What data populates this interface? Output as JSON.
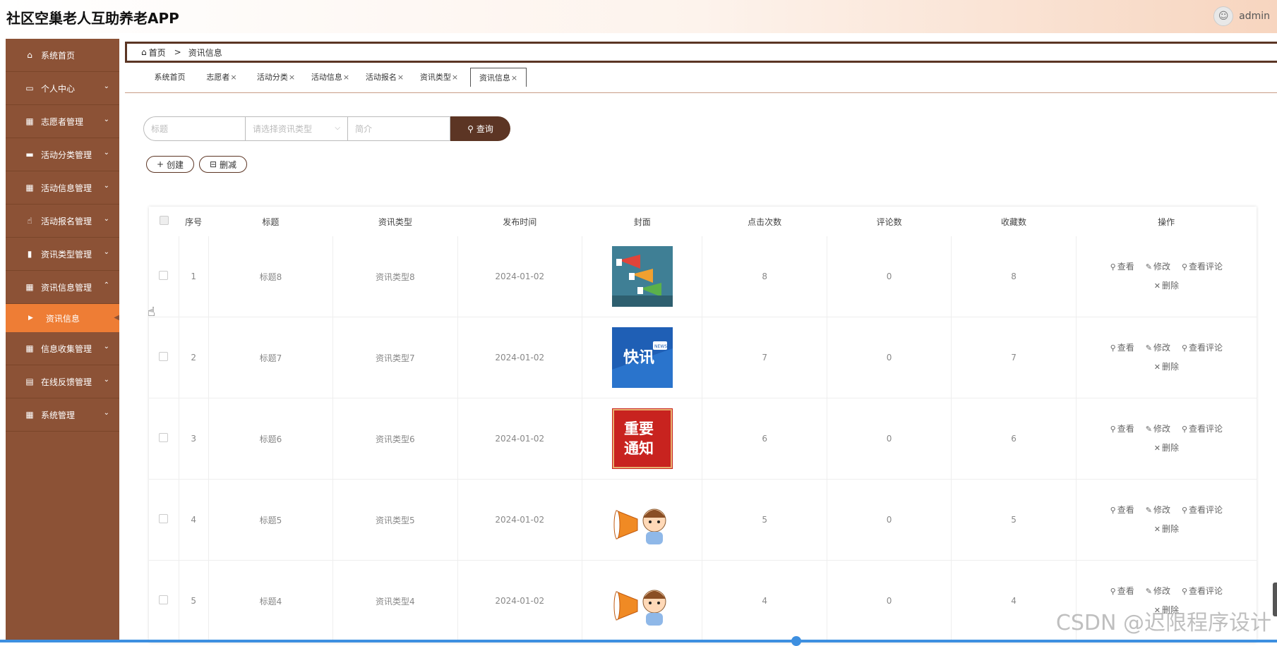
{
  "app": {
    "title": "社区空巢老人互助养老APP",
    "user": "admin"
  },
  "sidebar": {
    "items": [
      {
        "label": "系统首页",
        "icon": "home-icon",
        "chevron": ""
      },
      {
        "label": "个人中心",
        "icon": "calendar-icon",
        "chevron": "⌄"
      },
      {
        "label": "志愿者管理",
        "icon": "grid-icon",
        "chevron": "⌄"
      },
      {
        "label": "活动分类管理",
        "icon": "monitor-icon",
        "chevron": "⌄"
      },
      {
        "label": "活动信息管理",
        "icon": "grid-icon",
        "chevron": "⌄"
      },
      {
        "label": "活动报名管理",
        "icon": "thumb-icon",
        "chevron": "⌄"
      },
      {
        "label": "资讯类型管理",
        "icon": "bar-chart-icon",
        "chevron": "⌄"
      },
      {
        "label": "资讯信息管理",
        "icon": "grid-icon",
        "chevron": "⌃"
      }
    ],
    "active_sub": "资讯信息",
    "items_after": [
      {
        "label": "信息收集管理",
        "icon": "grid-icon",
        "chevron": "⌄"
      },
      {
        "label": "在线反馈管理",
        "icon": "clipboard-icon",
        "chevron": "⌄"
      },
      {
        "label": "系统管理",
        "icon": "grid-icon",
        "chevron": "⌄"
      }
    ]
  },
  "breadcrumb": {
    "home": "首页",
    "separator": ">",
    "current": "资讯信息"
  },
  "tabs": [
    {
      "label": "系统首页",
      "close": ""
    },
    {
      "label": "志愿者",
      "close": "×"
    },
    {
      "label": "活动分类",
      "close": "×"
    },
    {
      "label": "活动信息",
      "close": "×"
    },
    {
      "label": "活动报名",
      "close": "×"
    },
    {
      "label": "资讯类型",
      "close": "×"
    },
    {
      "label": "资讯信息",
      "close": "×"
    }
  ],
  "search": {
    "title_placeholder": "标题",
    "type_placeholder": "请选择资讯类型",
    "brief_placeholder": "简介",
    "button": "查询"
  },
  "actions": {
    "create": "创建",
    "delete": "删减"
  },
  "table": {
    "headers": [
      "序号",
      "标题",
      "资讯类型",
      "发布时间",
      "封面",
      "点击次数",
      "评论数",
      "收藏数",
      "操作"
    ],
    "ops": {
      "view": "查看",
      "edit": "修改",
      "comments": "查看评论",
      "remove": "删除"
    },
    "rows": [
      {
        "no": "1",
        "title": "标题8",
        "type": "资讯类型8",
        "date": "2024-01-02",
        "cover": "megaphones",
        "clicks": "8",
        "comments": "0",
        "favorites": "8"
      },
      {
        "no": "2",
        "title": "标题7",
        "type": "资讯类型7",
        "date": "2024-01-02",
        "cover": "kuaixun",
        "clicks": "7",
        "comments": "0",
        "favorites": "7"
      },
      {
        "no": "3",
        "title": "标题6",
        "type": "资讯类型6",
        "date": "2024-01-02",
        "cover": "notice",
        "clicks": "6",
        "comments": "0",
        "favorites": "6"
      },
      {
        "no": "4",
        "title": "标题5",
        "type": "资讯类型5",
        "date": "2024-01-02",
        "cover": "kid-megaphone",
        "clicks": "5",
        "comments": "0",
        "favorites": "5"
      },
      {
        "no": "5",
        "title": "标题4",
        "type": "资讯类型4",
        "date": "2024-01-02",
        "cover": "kid-megaphone",
        "clicks": "4",
        "comments": "0",
        "favorites": "4"
      }
    ]
  },
  "covers": {
    "kuaixun_text": "快讯",
    "news_tag": "NEWS",
    "notice_text": [
      "重要",
      "通知"
    ]
  },
  "watermark": "CSDN @迟限程序设计"
}
